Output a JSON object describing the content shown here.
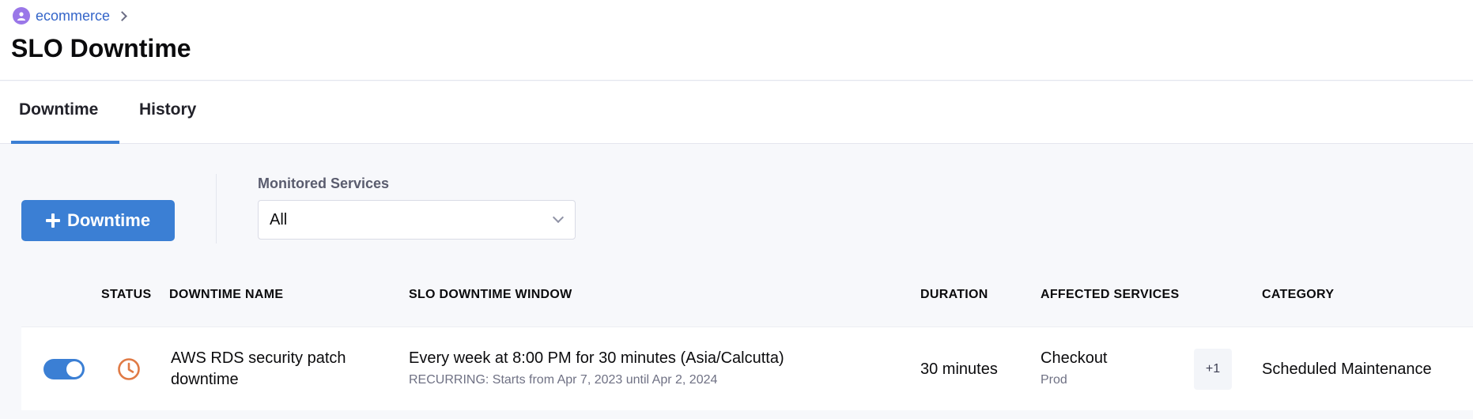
{
  "breadcrumb": {
    "project": "ecommerce"
  },
  "page": {
    "title": "SLO Downtime"
  },
  "tabs": [
    {
      "label": "Downtime",
      "active": true
    },
    {
      "label": "History",
      "active": false
    }
  ],
  "toolbar": {
    "add_button_label": "Downtime",
    "filter_label": "Monitored Services",
    "filter_value": "All"
  },
  "table": {
    "headers": [
      "STATUS",
      "DOWNTIME NAME",
      "SLO DOWNTIME WINDOW",
      "DURATION",
      "AFFECTED SERVICES",
      "CATEGORY"
    ],
    "rows": [
      {
        "enabled": true,
        "status_icon": "clock-icon",
        "name_line1": "AWS RDS security patch",
        "name_line2": "downtime",
        "window": "Every week at 8:00 PM for 30 minutes (Asia/Calcutta)",
        "window_detail": "RECURRING: Starts from Apr 7, 2023 until Apr 2, 2024",
        "duration": "30 minutes",
        "service": "Checkout",
        "environment": "Prod",
        "more_services": "+1",
        "category": "Scheduled Maintenance"
      }
    ]
  },
  "colors": {
    "accent": "#3b7fd4",
    "status_clock": "#e07a45",
    "project_icon": "#9a77e8"
  }
}
